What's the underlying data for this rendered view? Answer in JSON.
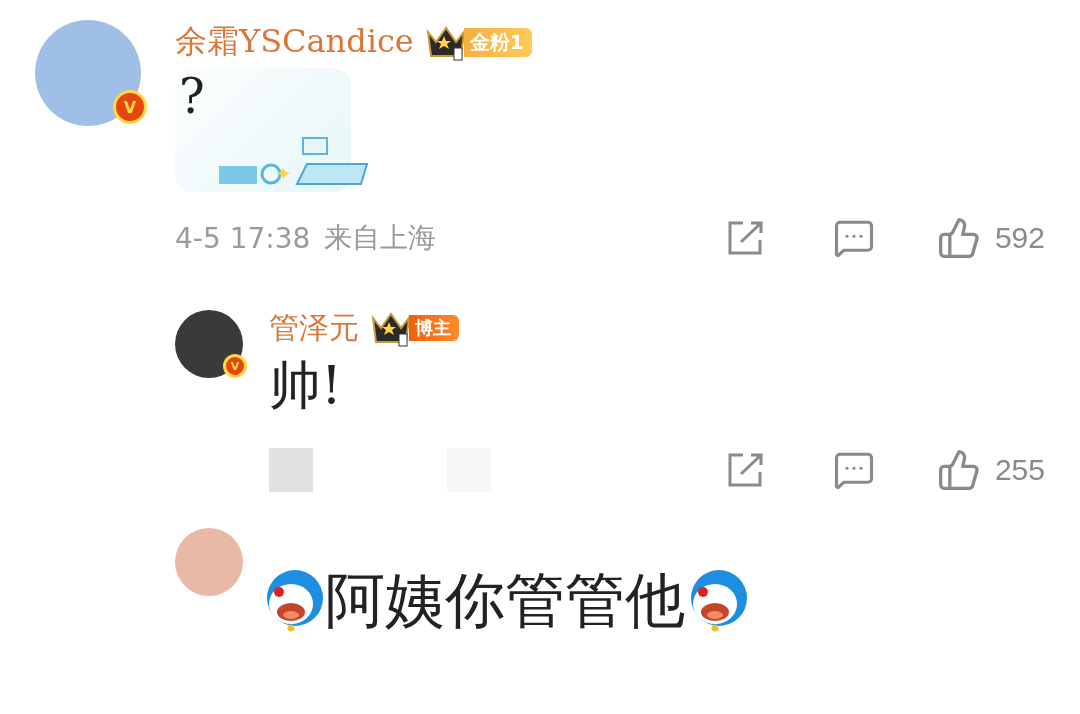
{
  "comments": [
    {
      "kind": "comment",
      "author": "余霜YSCandice",
      "verified_badge": "V",
      "badge": {
        "kind": "gold_fan",
        "label": "金粉1"
      },
      "content": {
        "kind": "sticker",
        "text": "?"
      },
      "time": "4-5 17:38",
      "location": "来自上海",
      "likes": "592"
    },
    {
      "kind": "reply",
      "author": "管泽元",
      "verified_badge": "V",
      "badge": {
        "kind": "blogger",
        "label": "博主"
      },
      "content": {
        "kind": "plain",
        "text": "帅!"
      },
      "likes": "255"
    },
    {
      "kind": "reply",
      "content": {
        "kind": "emoji_wrapped",
        "text": "阿姨你管管他"
      }
    }
  ]
}
